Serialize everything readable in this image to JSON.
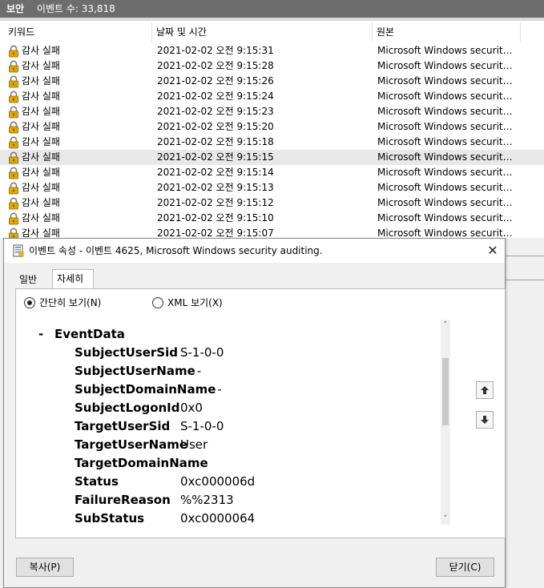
{
  "log": {
    "title": "보안",
    "event_count_label": "이벤트 수: 33,818",
    "columns": [
      "키워드",
      "날짜 및 시간",
      "원본"
    ],
    "rows": [
      {
        "keyword": "감사 실패",
        "datetime": "2021-02-02 오전 9:15:31",
        "source": "Microsoft Windows security a..."
      },
      {
        "keyword": "감사 실패",
        "datetime": "2021-02-02 오전 9:15:28",
        "source": "Microsoft Windows security a..."
      },
      {
        "keyword": "감사 실패",
        "datetime": "2021-02-02 오전 9:15:26",
        "source": "Microsoft Windows security a..."
      },
      {
        "keyword": "감사 실패",
        "datetime": "2021-02-02 오전 9:15:24",
        "source": "Microsoft Windows security a..."
      },
      {
        "keyword": "감사 실패",
        "datetime": "2021-02-02 오전 9:15:23",
        "source": "Microsoft Windows security a..."
      },
      {
        "keyword": "감사 실패",
        "datetime": "2021-02-02 오전 9:15:20",
        "source": "Microsoft Windows security a..."
      },
      {
        "keyword": "감사 실패",
        "datetime": "2021-02-02 오전 9:15:18",
        "source": "Microsoft Windows security a..."
      },
      {
        "keyword": "감사 실패",
        "datetime": "2021-02-02 오전 9:15:15",
        "source": "Microsoft Windows security a...",
        "selected": true
      },
      {
        "keyword": "감사 실패",
        "datetime": "2021-02-02 오전 9:15:14",
        "source": "Microsoft Windows security a..."
      },
      {
        "keyword": "감사 실패",
        "datetime": "2021-02-02 오전 9:15:13",
        "source": "Microsoft Windows security a..."
      },
      {
        "keyword": "감사 실패",
        "datetime": "2021-02-02 오전 9:15:12",
        "source": "Microsoft Windows security a..."
      },
      {
        "keyword": "감사 실패",
        "datetime": "2021-02-02 오전 9:15:10",
        "source": "Microsoft Windows security a..."
      },
      {
        "keyword": "감사 실패",
        "datetime": "2021-02-02 오전 9:15:07",
        "source": "Microsoft Windows security a..."
      }
    ]
  },
  "dialog": {
    "title": "이벤트 속성 - 이벤트 4625, Microsoft Windows security auditing.",
    "close_glyph": "✕",
    "tabs": [
      "일반",
      "자세히"
    ],
    "active_tab": "자세히",
    "view_friendly": "간단히 보기(N)",
    "view_xml": "XML 보기(X)",
    "selected_view": "friendly",
    "event_data": {
      "collapse_glyph": "-",
      "heading": "EventData",
      "fields": [
        {
          "key": "SubjectUserSid",
          "value": "S-1-0-0"
        },
        {
          "key": "SubjectUserName",
          "value": "-"
        },
        {
          "key": "SubjectDomainName",
          "value": "-"
        },
        {
          "key": "SubjectLogonId",
          "value": "0x0"
        },
        {
          "key": "TargetUserSid",
          "value": "S-1-0-0"
        },
        {
          "key": "TargetUserName",
          "value": "User"
        },
        {
          "key": "TargetDomainName",
          "value": ""
        },
        {
          "key": "Status",
          "value": "0xc000006d"
        },
        {
          "key": "FailureReason",
          "value": "%%2313"
        },
        {
          "key": "SubStatus",
          "value": "0xc0000064"
        }
      ]
    },
    "copy_button": "복사(P)",
    "close_button": "닫기(C)"
  },
  "icons": {
    "lock": "lock-icon",
    "dialog": "event-properties-icon",
    "up": "arrow-up-icon",
    "down": "arrow-down-icon",
    "close": "close-icon"
  },
  "colors": {
    "header_bg": "#6d6d6d",
    "selected_row": "#e8e8e8",
    "lock_gold": "#e0a800"
  }
}
